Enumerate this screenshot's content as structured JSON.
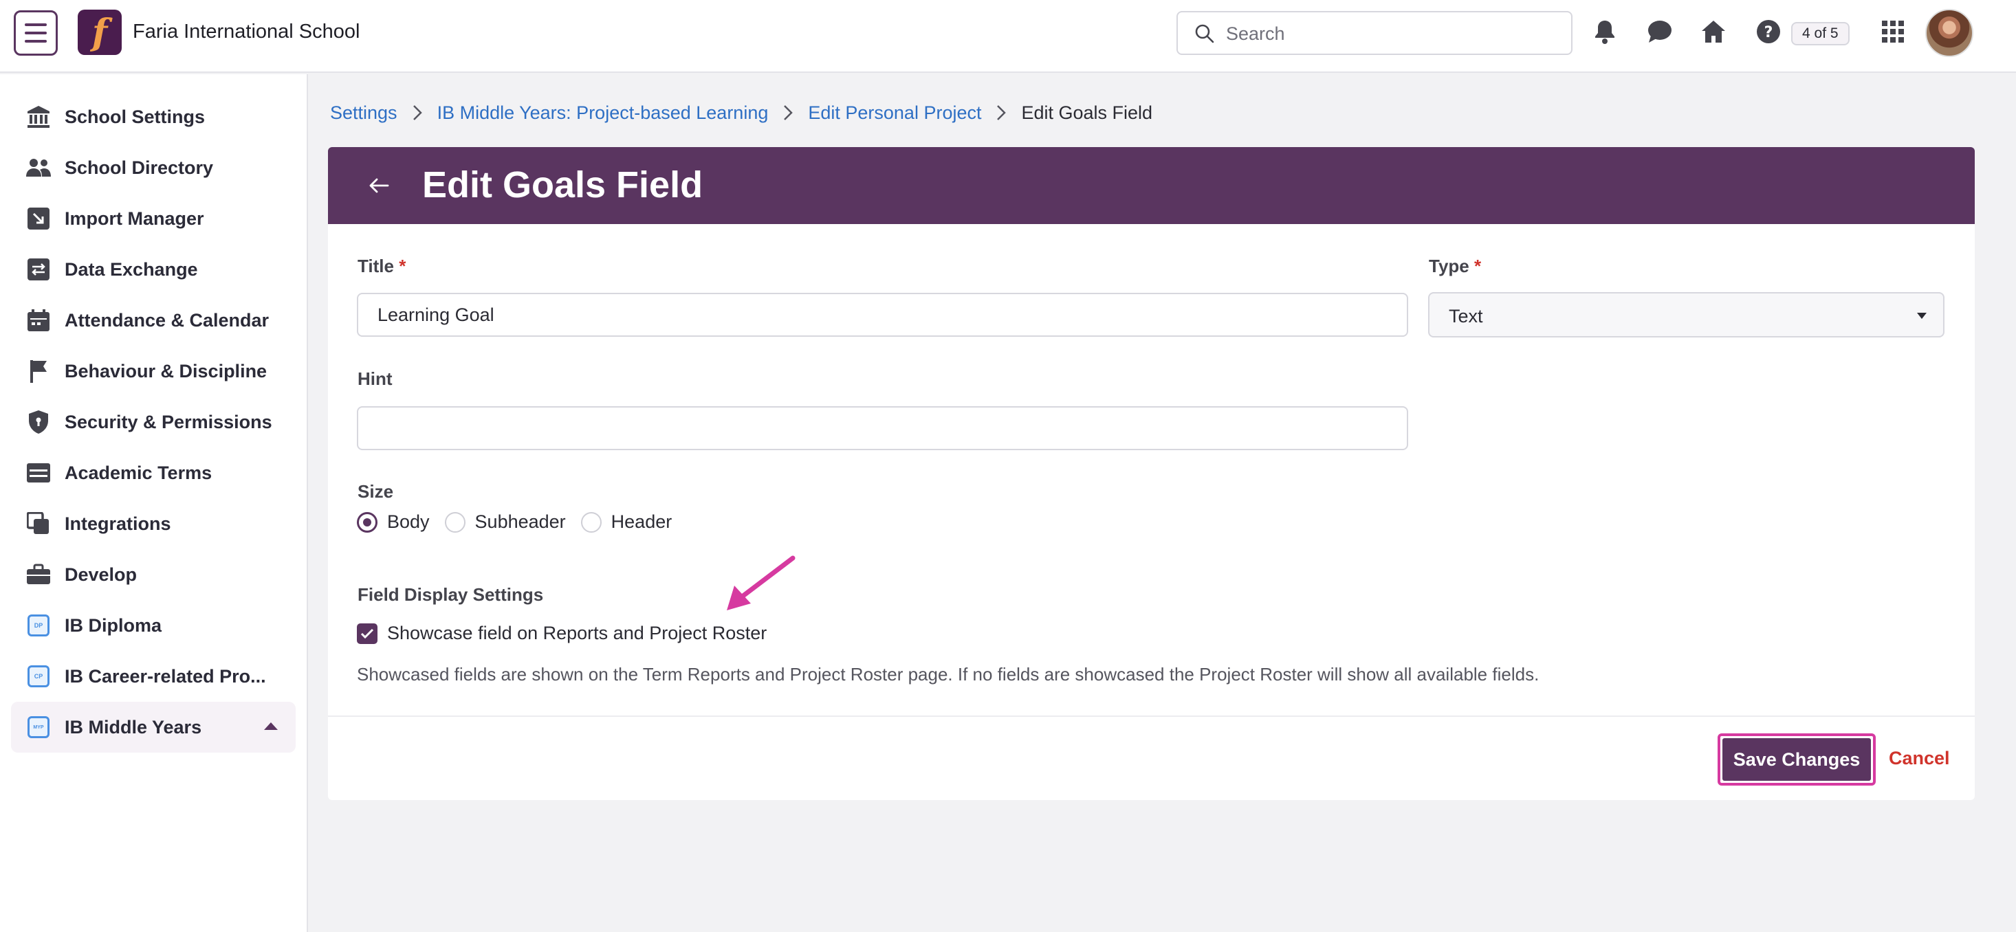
{
  "topbar": {
    "school_name": "Faria International School",
    "logo_letter": "f",
    "search_placeholder": "Search",
    "counter": "4 of 5",
    "icons": [
      "menu-icon",
      "bell-icon",
      "chat-icon",
      "home-icon",
      "help-icon",
      "apps-grid-icon"
    ]
  },
  "sidebar": {
    "items": [
      {
        "label": "School Settings",
        "icon": "bank-icon"
      },
      {
        "label": "School Directory",
        "icon": "people-icon"
      },
      {
        "label": "Import Manager",
        "icon": "import-icon"
      },
      {
        "label": "Data Exchange",
        "icon": "exchange-icon"
      },
      {
        "label": "Attendance & Calendar",
        "icon": "calendar-icon"
      },
      {
        "label": "Behaviour & Discipline",
        "icon": "flag-icon"
      },
      {
        "label": "Security & Permissions",
        "icon": "shield-icon"
      },
      {
        "label": "Academic Terms",
        "icon": "terms-icon"
      },
      {
        "label": "Integrations",
        "icon": "integrations-icon"
      },
      {
        "label": "Develop",
        "icon": "briefcase-icon"
      },
      {
        "label": "IB Diploma",
        "icon": "ib-dp-icon",
        "badge": "DP"
      },
      {
        "label": "IB Career-related Pro...",
        "icon": "ib-cp-icon",
        "badge": "CP"
      },
      {
        "label": "IB Middle Years",
        "icon": "ib-myp-icon",
        "badge": "MYP",
        "active": true
      }
    ]
  },
  "breadcrumb": {
    "items": [
      "Settings",
      "IB Middle Years: Project-based Learning",
      "Edit Personal Project"
    ],
    "current": "Edit Goals Field"
  },
  "form": {
    "page_title": "Edit Goals Field",
    "title_label": "Title",
    "title_value": "Learning Goal",
    "required_mark": "*",
    "type_label": "Type",
    "type_value": "Text",
    "hint_label": "Hint",
    "hint_value": "",
    "size_label": "Size",
    "size_options": [
      "Body",
      "Subheader",
      "Header"
    ],
    "size_selected": "Body",
    "display_settings_label": "Field Display Settings",
    "showcase_label": "Showcase field on Reports and Project Roster",
    "showcase_checked": true,
    "help_text": "Showcased fields are shown on the Term Reports and Project Roster page. If no fields are showcased the Project Roster will show all available fields.",
    "save_label": "Save Changes",
    "cancel_label": "Cancel"
  },
  "colors": {
    "brand": "#5a3560",
    "link": "#2e6fc4",
    "danger": "#d0342c",
    "highlight": "#d63aa0"
  }
}
